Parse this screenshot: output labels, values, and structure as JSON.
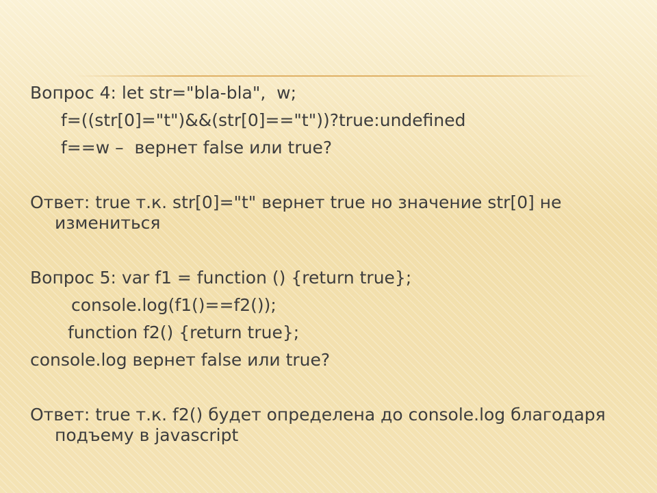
{
  "slide": {
    "lines": [
      "Вопрос 4: let str=\"bla-bla\",  w;",
      "f=((str[0]=\"t\")&&(str[0]==\"t\"))?true:undefined",
      "f==w –  вернет false или true?",
      "Ответ: true т.к. str[0]=\"t\"    вернет true но значение str[0] не измениться",
      "Вопрос 5: var f1 = function () {return true};",
      "console.log(f1()==f2());",
      "function f2() {return true};",
      "console.log вернет false или true?",
      "Ответ: true т.к. f2() будет определена до console.log благодаря подъему в javascript"
    ]
  },
  "colors": {
    "text": "#3d3d3d",
    "background": "#f5e7bd",
    "divider": "#dcaa5a"
  }
}
